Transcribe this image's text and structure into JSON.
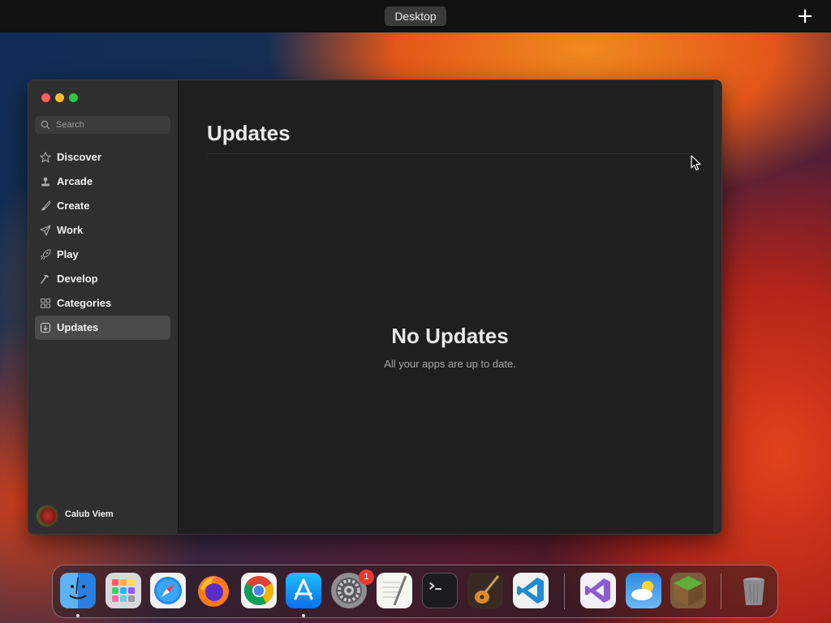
{
  "topbar": {
    "desktop_label": "Desktop",
    "add_button": "+"
  },
  "window": {
    "search": {
      "placeholder": "Search"
    },
    "sidebar": {
      "items": [
        {
          "label": "Discover",
          "icon": "star-icon"
        },
        {
          "label": "Arcade",
          "icon": "joystick-icon"
        },
        {
          "label": "Create",
          "icon": "brush-icon"
        },
        {
          "label": "Work",
          "icon": "paper-plane-icon"
        },
        {
          "label": "Play",
          "icon": "rocket-icon"
        },
        {
          "label": "Develop",
          "icon": "hammer-icon"
        },
        {
          "label": "Categories",
          "icon": "grid-icon"
        },
        {
          "label": "Updates",
          "icon": "download-icon",
          "active": true
        }
      ],
      "user": {
        "name": "Calub Viem"
      }
    },
    "main": {
      "title": "Updates",
      "empty_title": "No Updates",
      "empty_subtitle": "All your apps are up to date."
    }
  },
  "dock": {
    "apps": [
      "finder",
      "launchpad",
      "safari",
      "firefox",
      "chrome",
      "app-store",
      "system-settings",
      "textedit",
      "terminal",
      "garageband",
      "vscode",
      "visual-studio",
      "weather",
      "minecraft",
      "trash"
    ],
    "settings_badge": "1"
  },
  "colors": {
    "window_bg": "#1f1f1f",
    "sidebar_bg": "#2f2f2f",
    "active_item": "#4a4a4a",
    "badge": "#e6392f"
  }
}
